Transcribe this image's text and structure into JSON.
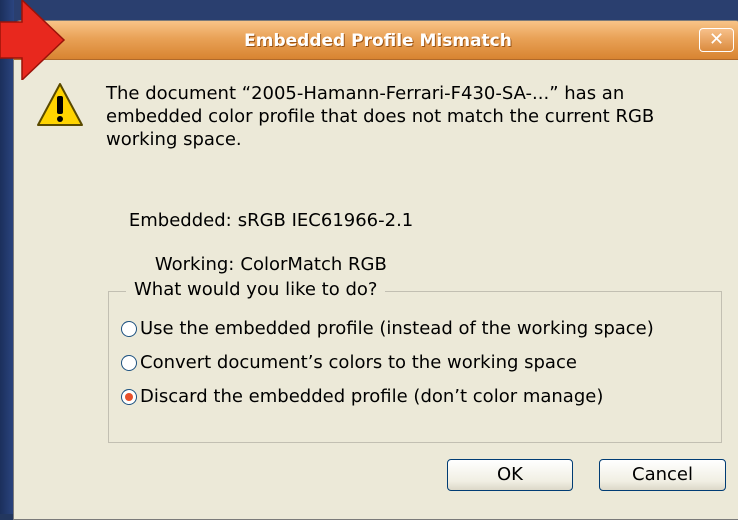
{
  "dialog": {
    "title": "Embedded Profile Mismatch",
    "close_label": "✕",
    "message": "The document “2005-Hamann-Ferrari-F430-SA-...” has an embedded color profile that does not match the current RGB working space.",
    "embedded_label": "Embedded:",
    "embedded_value": "sRGB IEC61966-2.1",
    "working_label": "Working:",
    "working_value": "ColorMatch RGB",
    "group_label": "What would you like to do?",
    "options": [
      {
        "label": "Use the embedded profile (instead of the working space)",
        "selected": false
      },
      {
        "label": "Convert document’s colors to the working space",
        "selected": false
      },
      {
        "label": "Discard the embedded profile (don’t color manage)",
        "selected": true
      }
    ],
    "ok_label": "OK",
    "cancel_label": "Cancel",
    "icon": "warning-icon"
  },
  "colors": {
    "titlebar": "#e9a257",
    "dialog_bg": "#ece9d8",
    "desktop": "#23375f",
    "annotation_arrow": "#e8281e",
    "radio_dot": "#e8502a"
  }
}
